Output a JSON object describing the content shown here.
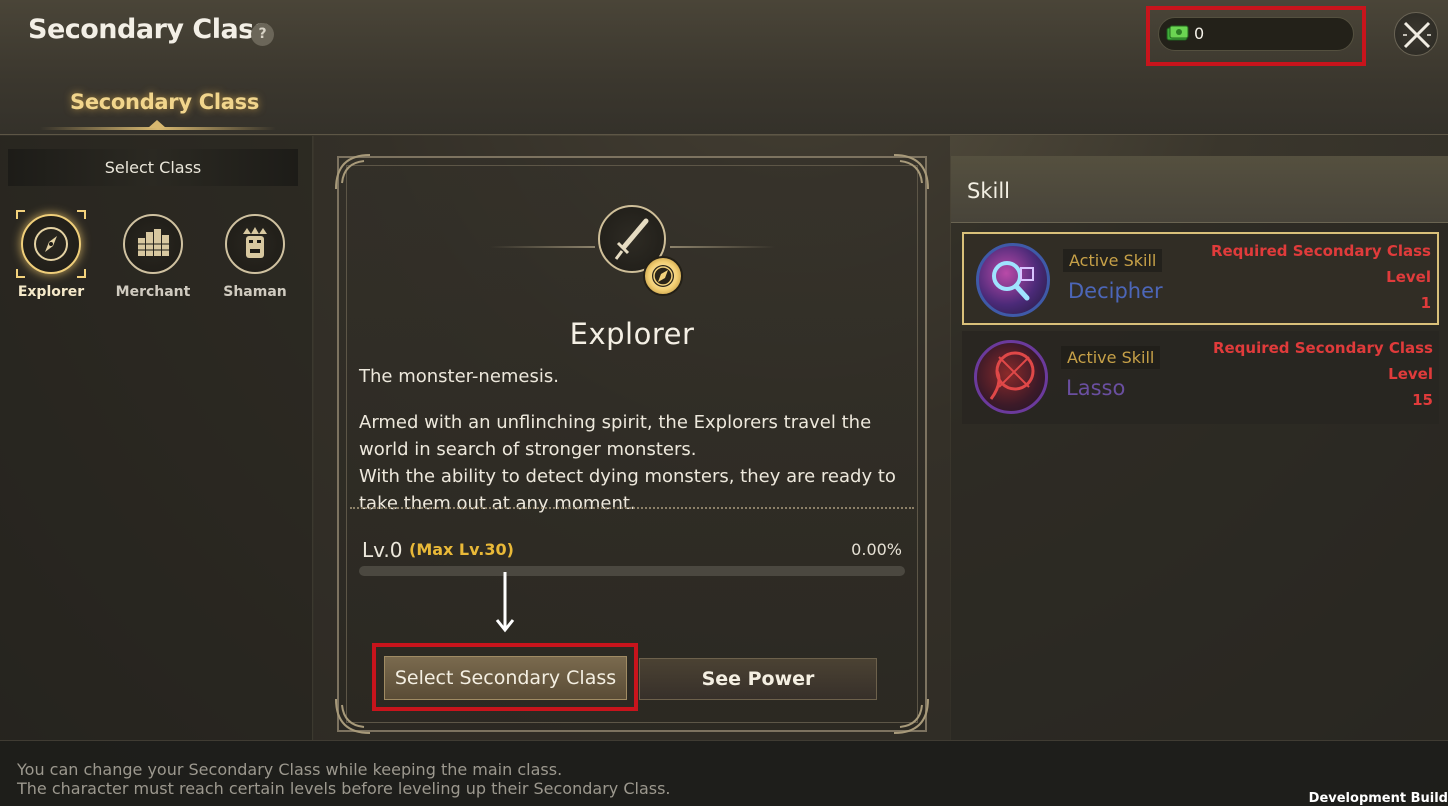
{
  "header": {
    "title": "Secondary Class",
    "help_icon_glyph": "?",
    "currency_value": "0",
    "currency_icon": "money-icon",
    "close_icon": "close-icon"
  },
  "tabs": [
    {
      "label": "Secondary Class",
      "active": true
    }
  ],
  "sidebar": {
    "header": "Select Class",
    "classes": [
      {
        "label": "Explorer",
        "icon": "compass-icon",
        "selected": true
      },
      {
        "label": "Merchant",
        "icon": "coin-stack-icon",
        "selected": false
      },
      {
        "label": "Shaman",
        "icon": "totem-icon",
        "selected": false
      }
    ]
  },
  "detail": {
    "class_name": "Explorer",
    "emblem_icon": "dagger-icon",
    "tagline": "The monster-nemesis.",
    "description_1": "Armed with an unflinching spirit, the Explorers travel the world in search of stronger monsters.",
    "description_2": "With the ability to detect dying monsters, they are ready to take them out at any moment.",
    "level": "Lv.0",
    "max_level": "(Max Lv.30)",
    "progress_text": "0.00%",
    "progress_fraction": 0.0,
    "select_button": "Select Secondary Class",
    "see_power_button": "See Power"
  },
  "skills": {
    "title": "Skill",
    "items": [
      {
        "type": "Active Skill",
        "name": "Decipher",
        "required_label": "Required Secondary Class Level",
        "required_level": "1",
        "name_color": "#4c66b8",
        "icon": "magnifier-icon",
        "selected": true
      },
      {
        "type": "Active Skill",
        "name": "Lasso",
        "required_label": "Required Secondary Class Level",
        "required_level": "15",
        "name_color": "#6a4fa0",
        "icon": "lasso-icon",
        "selected": false
      }
    ]
  },
  "footer": {
    "line_1": "You can change your Secondary Class while keeping the main class.",
    "line_2": "The character must reach certain levels before leveling up their Secondary Class.",
    "build_label": "Development Build"
  },
  "colors": {
    "accent_gold": "#d8b870",
    "highlight_red": "#c8141c",
    "required_red": "#e03b3b",
    "max_level_yellow": "#e9b938"
  }
}
